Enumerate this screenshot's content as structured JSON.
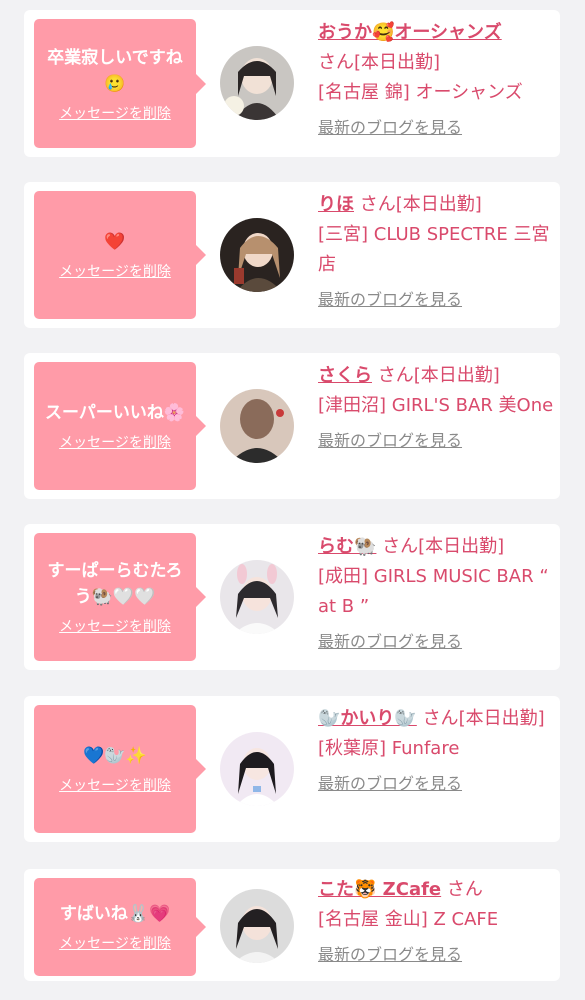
{
  "accent_color": "#d94a6c",
  "bubble_color": "#ff9ba8",
  "items": [
    {
      "message": "卒業寂しいですね🥲",
      "delete_label": "メッセージを削除",
      "name": "おうか🥰オーシャンズ",
      "san": "さん",
      "status": "[本日出勤]",
      "shop": "[名古屋 錦] オーシャンズ",
      "blog_label": "最新のブログを見る",
      "avatar_icon": "avatar-photo"
    },
    {
      "message": "❤️",
      "delete_label": "メッセージを削除",
      "name": "りほ",
      "san": "さん",
      "status": "[本日出勤]",
      "shop": "[三宮] CLUB SPECTRE 三宮店",
      "blog_label": "最新のブログを見る",
      "avatar_icon": "avatar-photo"
    },
    {
      "message": "スーパーいいね🌸",
      "delete_label": "メッセージを削除",
      "name": "さくら",
      "san": "さん",
      "status": "[本日出勤]",
      "shop": "[津田沼] GIRL'S BAR 美One",
      "blog_label": "最新のブログを見る",
      "avatar_icon": "avatar-photo"
    },
    {
      "message": "すーぱーらむたろう🐏🤍🤍",
      "delete_label": "メッセージを削除",
      "name": "らむ🐏",
      "san": "さん",
      "status": "[本日出勤]",
      "shop": "[成田] GIRLS MUSIC BAR “ at B ”",
      "blog_label": "最新のブログを見る",
      "avatar_icon": "avatar-photo"
    },
    {
      "message": "💙🦭✨",
      "delete_label": "メッセージを削除",
      "name": "🦭かいり🦭",
      "san": "さん",
      "status": "[本日出勤]",
      "shop": "[秋葉原] Funfare",
      "blog_label": "最新のブログを見る",
      "avatar_icon": "avatar-photo"
    },
    {
      "message": "すばいね🐰💗",
      "delete_label": "メッセージを削除",
      "name": "こた🐯 ZCafe",
      "san": "さん",
      "status": "",
      "shop": "[名古屋 金山] Z CAFE",
      "blog_label": "最新のブログを見る",
      "avatar_icon": "avatar-photo"
    }
  ]
}
